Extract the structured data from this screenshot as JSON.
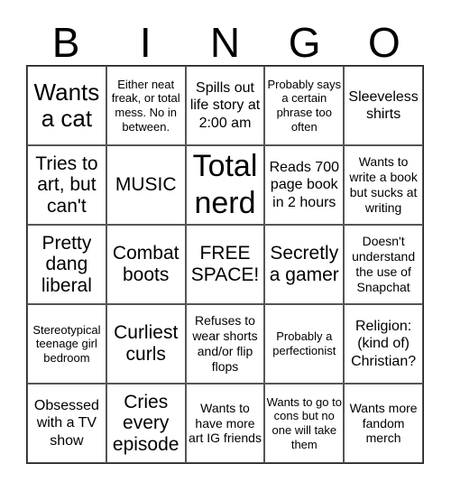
{
  "header": {
    "letters": [
      "B",
      "I",
      "N",
      "G",
      "O"
    ]
  },
  "cells": [
    {
      "text": "Wants a cat",
      "size": "l"
    },
    {
      "text": "Either neat freak, or total mess. No in between.",
      "size": "xs"
    },
    {
      "text": "Spills out life story at 2:00 am",
      "size": "n"
    },
    {
      "text": "Probably says a certain phrase too often",
      "size": "xs"
    },
    {
      "text": "Sleeveless shirts",
      "size": "n"
    },
    {
      "text": "Tries to art, but can't",
      "size": "m"
    },
    {
      "text": "MUSIC",
      "size": "m"
    },
    {
      "text": "Total nerd",
      "size": "xl"
    },
    {
      "text": "Reads 700 page book in 2 hours",
      "size": "n"
    },
    {
      "text": "Wants to write a book but sucks at writing",
      "size": "s"
    },
    {
      "text": "Pretty dang liberal",
      "size": "m"
    },
    {
      "text": "Combat boots",
      "size": "m"
    },
    {
      "text": "FREE SPACE!",
      "size": "m"
    },
    {
      "text": "Secretly a gamer",
      "size": "m"
    },
    {
      "text": "Doesn't understand the use of Snapchat",
      "size": "s"
    },
    {
      "text": "Stereotypical teenage girl bedroom",
      "size": "xs"
    },
    {
      "text": "Curliest curls",
      "size": "m"
    },
    {
      "text": "Refuses to wear shorts and/or flip flops",
      "size": "s"
    },
    {
      "text": "Probably a perfectionist",
      "size": "xs"
    },
    {
      "text": "Religion: (kind of) Christian?",
      "size": "n"
    },
    {
      "text": "Obsessed with a TV show",
      "size": "n"
    },
    {
      "text": "Cries every episode",
      "size": "m"
    },
    {
      "text": "Wants to have more art IG friends",
      "size": "s"
    },
    {
      "text": "Wants to go to cons but no one will take them",
      "size": "xs"
    },
    {
      "text": "Wants more fandom merch",
      "size": "s"
    }
  ]
}
